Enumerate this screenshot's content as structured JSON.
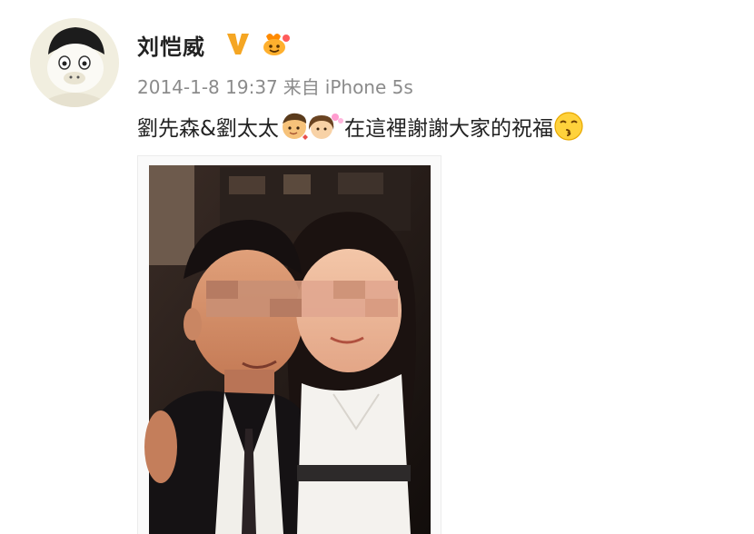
{
  "post": {
    "author": "刘恺威",
    "verified_icon": "verified-v-badge-icon",
    "member_icon": "weibo-member-badge-icon",
    "timestamp": "2014-1-8 19:37",
    "source_prefix": "来自",
    "source_device": "iPhone 5s",
    "text_part1": "劉先森&劉太太",
    "text_part2": "在這裡謝謝大家的祝福",
    "text_emoji_1": "couple-emoji-icon",
    "text_emoji_2": "kiss-emoji-icon",
    "image_icon": "couple-selfie-photo"
  },
  "colors": {
    "username": "#222222",
    "meta": "#8b8b8b",
    "badge_orange": "#f5a623"
  }
}
